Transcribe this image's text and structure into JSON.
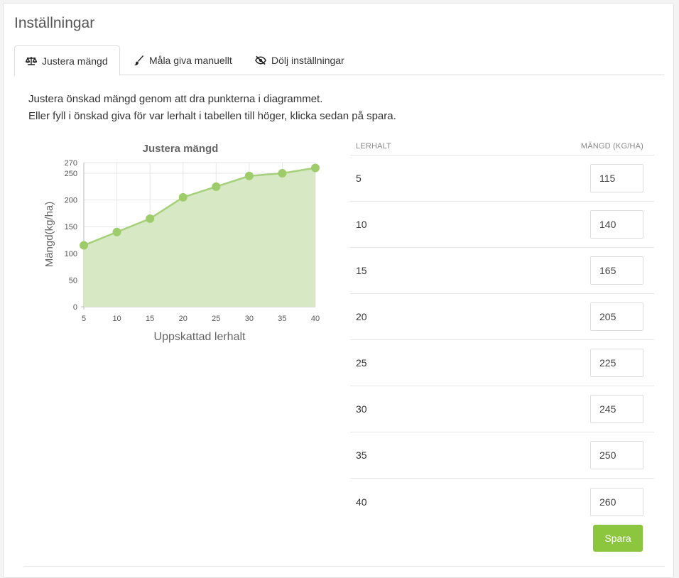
{
  "panel": {
    "title": "Inställningar"
  },
  "tabs": [
    {
      "label": "Justera mängd",
      "icon": "balance-scale-icon",
      "active": true
    },
    {
      "label": "Måla giva manuellt",
      "icon": "paint-brush-icon",
      "active": false
    },
    {
      "label": "Dölj inställningar",
      "icon": "eye-slash-icon",
      "active": false
    }
  ],
  "intro": {
    "line1": "Justera önskad mängd genom att dra punkterna i diagrammet.",
    "line2": "Eller fyll i önskad giva för var lerhalt i tabellen till höger, klicka sedan på spara."
  },
  "table": {
    "col_lerhalt": "LERHALT",
    "col_mangd": "MÄNGD (KG/HA)",
    "rows": [
      {
        "lerhalt": "5",
        "mangd": "115"
      },
      {
        "lerhalt": "10",
        "mangd": "140"
      },
      {
        "lerhalt": "15",
        "mangd": "165"
      },
      {
        "lerhalt": "20",
        "mangd": "205"
      },
      {
        "lerhalt": "25",
        "mangd": "225"
      },
      {
        "lerhalt": "30",
        "mangd": "245"
      },
      {
        "lerhalt": "35",
        "mangd": "250"
      },
      {
        "lerhalt": "40",
        "mangd": "260"
      }
    ]
  },
  "save_label": "Spara",
  "colors": {
    "accent": "#8cc63f",
    "series_line": "#a5d07a",
    "series_fill": "#d6e8c4",
    "point": "#9fcc6b"
  },
  "chart_data": {
    "type": "area",
    "title": "Justera mängd",
    "xlabel": "Uppskattad lerhalt",
    "ylabel": "Mängd(kg/ha)",
    "x": [
      5,
      10,
      15,
      20,
      25,
      30,
      35,
      40
    ],
    "series": [
      {
        "values": [
          115,
          140,
          165,
          205,
          225,
          245,
          250,
          260
        ]
      }
    ],
    "xlim": [
      5,
      40
    ],
    "ylim": [
      0,
      270
    ],
    "yticks": [
      0,
      50,
      100,
      150,
      200,
      250,
      270
    ],
    "xticks": [
      5,
      10,
      15,
      20,
      25,
      30,
      35,
      40
    ],
    "grid": true
  }
}
